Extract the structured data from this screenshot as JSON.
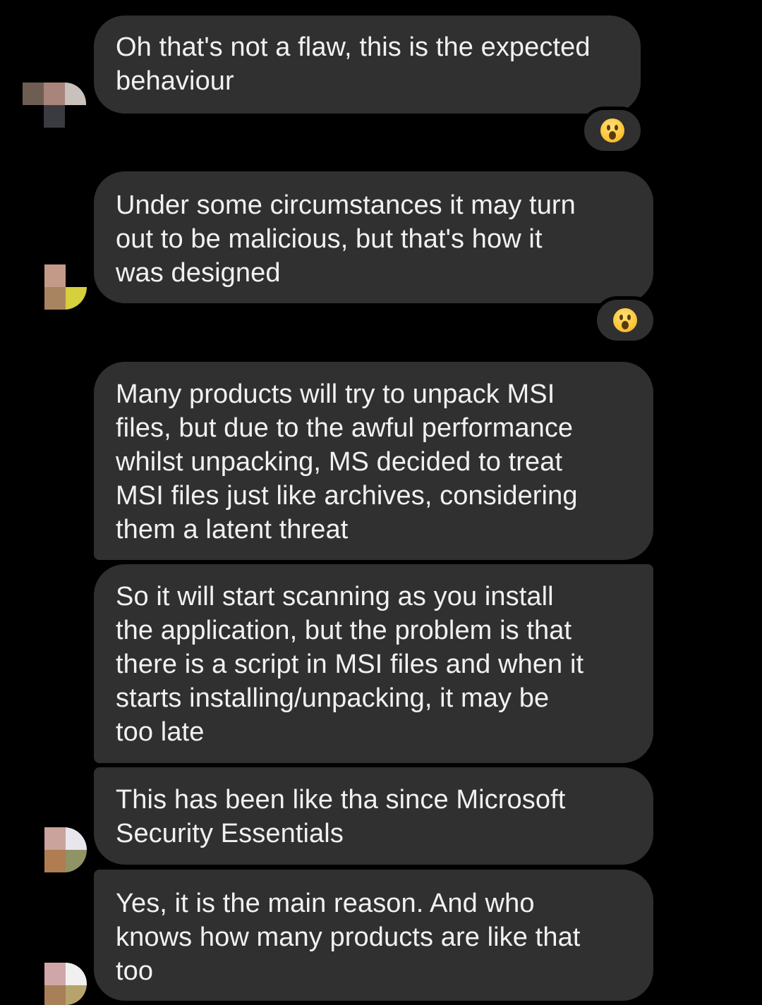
{
  "messages": [
    {
      "text": "Oh that's not a flaw, this is the expected\nbehaviour"
    },
    {
      "text": "Under some circumstances it may turn\nout to be malicious, but that's how it\nwas designed"
    },
    {
      "text": "Many products will try to unpack MSI\nfiles, but due to the awful performance\nwhilst unpacking, MS decided to treat\nMSI files just like archives, considering\nthem a latent threat"
    },
    {
      "text": "So it will start scanning as you install\nthe application, but the problem is that\nthere is a script in MSI files and when it\nstarts installing/unpacking, it may be\ntoo late"
    },
    {
      "text": "This has been like tha  since Microsoft\nSecurity Essentials"
    },
    {
      "text": "Yes, it is the main reason. And who\nknows how many products are like that\ntoo"
    }
  ],
  "reactions": [
    {
      "emoji": "surprised-face-icon"
    },
    {
      "emoji": "surprised-face-icon"
    }
  ],
  "colors": {
    "background": "#000000",
    "bubble": "#2f302f",
    "text": "#f1f1f1"
  }
}
